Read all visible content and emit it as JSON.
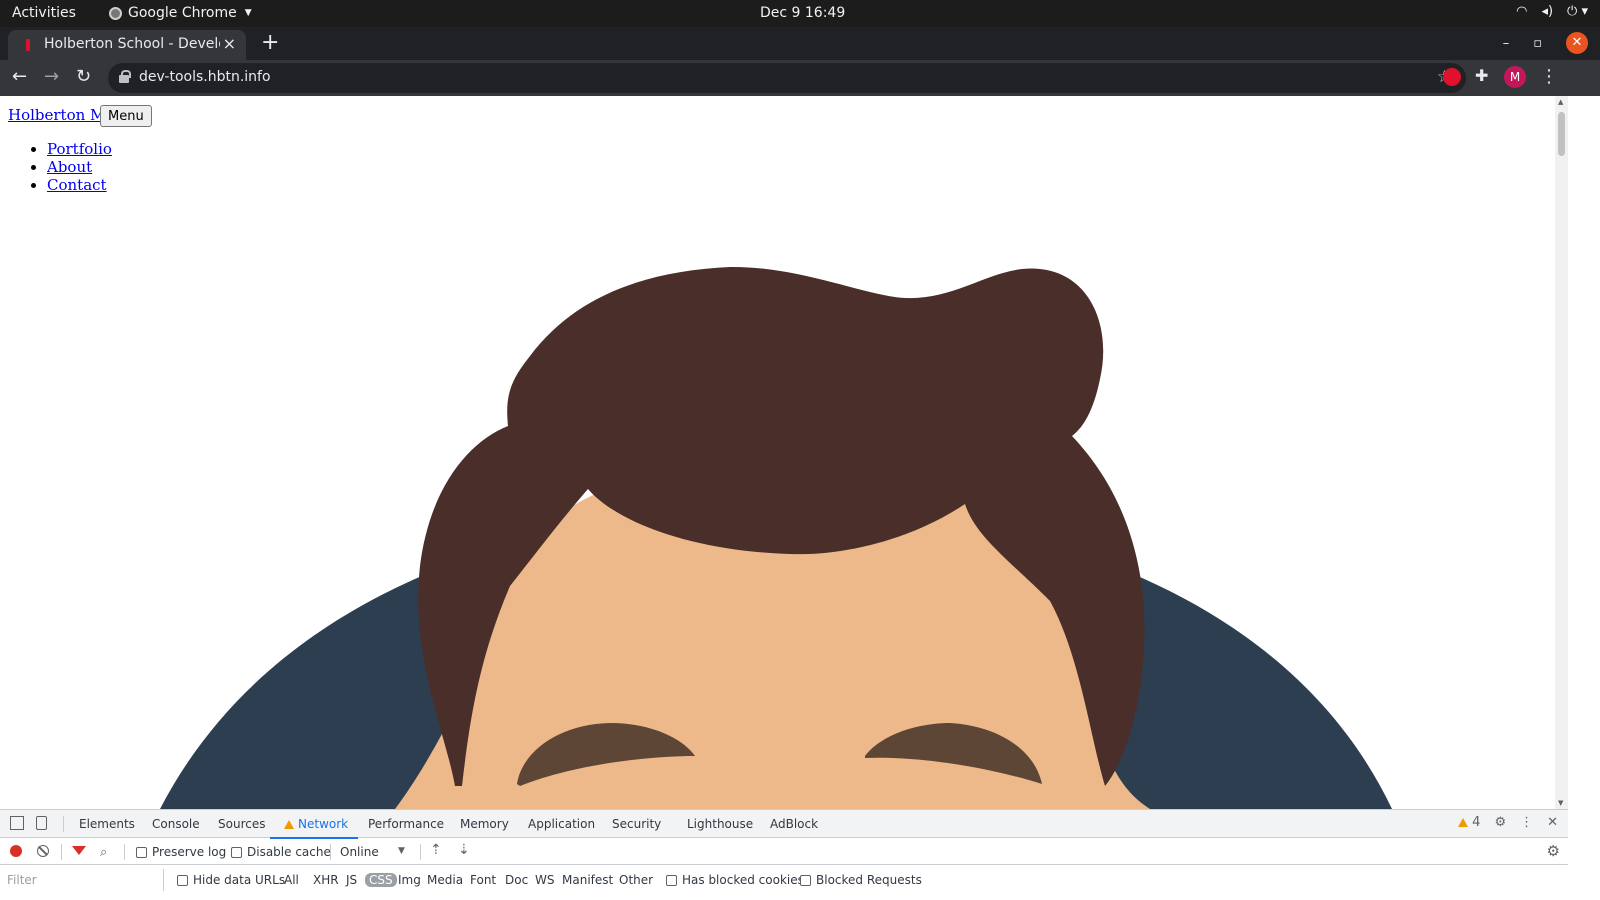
{
  "system_bar": {
    "activities": "Activities",
    "app_name": "Google Chrome",
    "clock": "Dec 9  16:49"
  },
  "browser": {
    "tab_title": "Holberton School - Developer Tools",
    "tab_close": "×",
    "new_tab": "+",
    "url": "dev-tools.hbtn.info",
    "profile_initial": "M",
    "window_minimize": "–",
    "window_restore": "▫",
    "window_close": "✕"
  },
  "page": {
    "brand_link": "Holberton Me",
    "menu_button": "Menu",
    "nav_links": [
      "Portfolio",
      "About",
      "Contact"
    ],
    "colors": {
      "shirt": "#2c3e50",
      "skin": "#edb98a",
      "hair": "#4a2e2a",
      "eyebrow": "#5e4636"
    }
  },
  "devtools": {
    "panel_tabs": [
      "Elements",
      "Console",
      "Sources",
      "Network",
      "Performance",
      "Memory",
      "Application",
      "Security",
      "Lighthouse",
      "AdBlock"
    ],
    "active_tab": "Network",
    "warning_count": "4",
    "preserve_log": "Preserve log",
    "disable_cache": "Disable cache",
    "throttling": "Online",
    "filter_placeholder": "Filter",
    "hide_data_urls": "Hide data URLs",
    "type_filters": [
      "All",
      "XHR",
      "JS",
      "CSS",
      "Img",
      "Media",
      "Font",
      "Doc",
      "WS",
      "Manifest",
      "Other"
    ],
    "selected_type": "CSS",
    "has_blocked_cookies": "Has blocked cookies",
    "blocked_requests": "Blocked Requests"
  }
}
